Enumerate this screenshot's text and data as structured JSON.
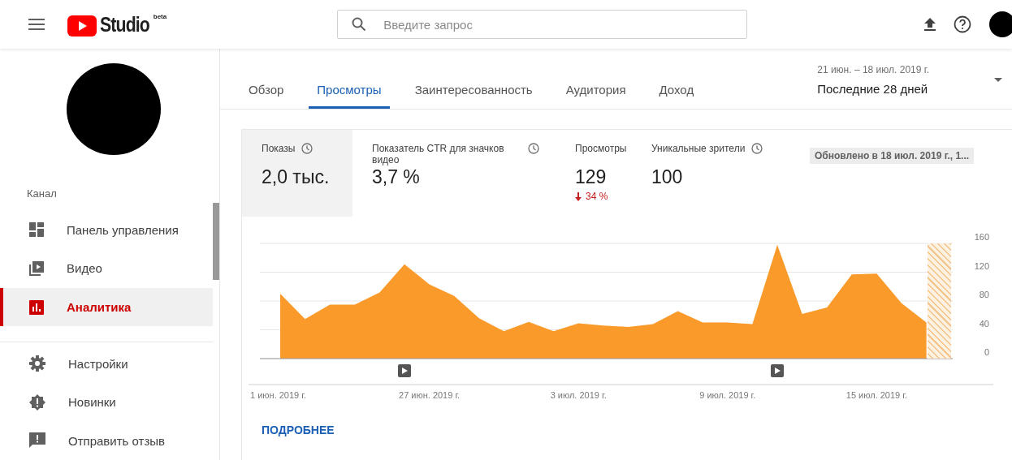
{
  "header": {
    "logo_text": "Studio",
    "logo_badge": "beta",
    "search": {
      "placeholder": "Введите запрос"
    }
  },
  "sidebar": {
    "section_label": "Канал",
    "items": [
      {
        "label": "Панель управления",
        "kind": "dashboard",
        "selected": false
      },
      {
        "label": "Видео",
        "kind": "video",
        "selected": false
      },
      {
        "label": "Аналитика",
        "kind": "analytics",
        "selected": true
      }
    ],
    "bottom_items": [
      {
        "label": "Настройки",
        "kind": "settings"
      },
      {
        "label": "Новинки",
        "kind": "news"
      },
      {
        "label": "Отправить отзыв",
        "kind": "feedback"
      }
    ]
  },
  "tabs": [
    {
      "label": "Обзор",
      "selected": false
    },
    {
      "label": "Просмотры",
      "selected": true
    },
    {
      "label": "Заинтересованность",
      "selected": false
    },
    {
      "label": "Аудитория",
      "selected": false
    },
    {
      "label": "Доход",
      "selected": false
    }
  ],
  "date_range": {
    "dates": "21 июн. – 18 июл. 2019 г.",
    "label": "Последние 28 дней"
  },
  "metrics": [
    {
      "label": "Показы",
      "value": "2,0 тыс.",
      "info": true,
      "selected": true
    },
    {
      "label": "Показатель CTR для значков видео",
      "value": "3,7 %",
      "info": true,
      "selected": false
    },
    {
      "label": "Просмотры",
      "value": "129",
      "info": false,
      "selected": false,
      "delta": "34 %"
    },
    {
      "label": "Уникальные зрители",
      "value": "100",
      "info": true,
      "selected": false
    }
  ],
  "updated": "Обновлено в 18 июл. 2019 г., 1...",
  "chart_data": {
    "type": "area",
    "categories": [
      "1 июн. 2019 г.",
      null,
      null,
      null,
      null,
      null,
      "27 июн. 2019 г.",
      null,
      null,
      null,
      null,
      null,
      "3 июл. 2019 г.",
      null,
      null,
      null,
      null,
      null,
      "9 июл. 2019 г.",
      null,
      null,
      null,
      null,
      null,
      "15 июл. 2019 г.",
      null,
      null
    ],
    "series": [
      {
        "color": "#f99a2a",
        "values": [
          90,
          55,
          75,
          75,
          92,
          131,
          103,
          87,
          56,
          38,
          51,
          38,
          49,
          46,
          44,
          48,
          66,
          50,
          50,
          48,
          158,
          62,
          71,
          117,
          118,
          77,
          50
        ]
      }
    ],
    "ylim": [
      0,
      160
    ],
    "yticks": [
      0,
      40,
      80,
      120,
      160
    ],
    "grid": true
  },
  "more_link": "ПОДРОБНЕЕ"
}
